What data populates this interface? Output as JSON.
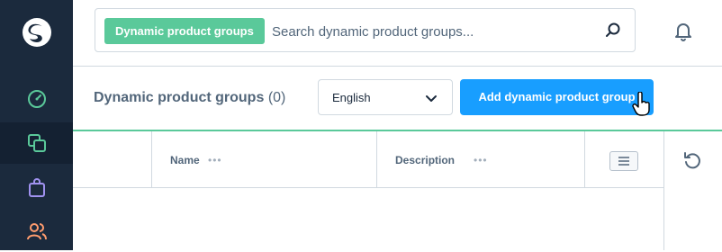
{
  "nav": {
    "items": [
      {
        "icon": "dashboard-icon",
        "color": "#5ac99a"
      },
      {
        "icon": "catalogues-icon",
        "color": "#5ac99a",
        "active": true
      },
      {
        "icon": "orders-icon",
        "color": "#a092f0"
      },
      {
        "icon": "customers-icon",
        "color": "#ff9c6e"
      }
    ]
  },
  "search": {
    "tag": "Dynamic product groups",
    "placeholder": "Search dynamic product groups..."
  },
  "smartbar": {
    "title": "Dynamic product groups",
    "count": "(0)",
    "language": "English",
    "add_button": "Add dynamic product group"
  },
  "grid": {
    "columns": [
      {
        "label": "Name"
      },
      {
        "label": "Description"
      }
    ],
    "column_menu": "•••"
  },
  "colors": {
    "nav_bg": "#1b2a3d",
    "accent_green": "#5ac99a",
    "primary_blue": "#189eff",
    "text": "#52667a"
  }
}
